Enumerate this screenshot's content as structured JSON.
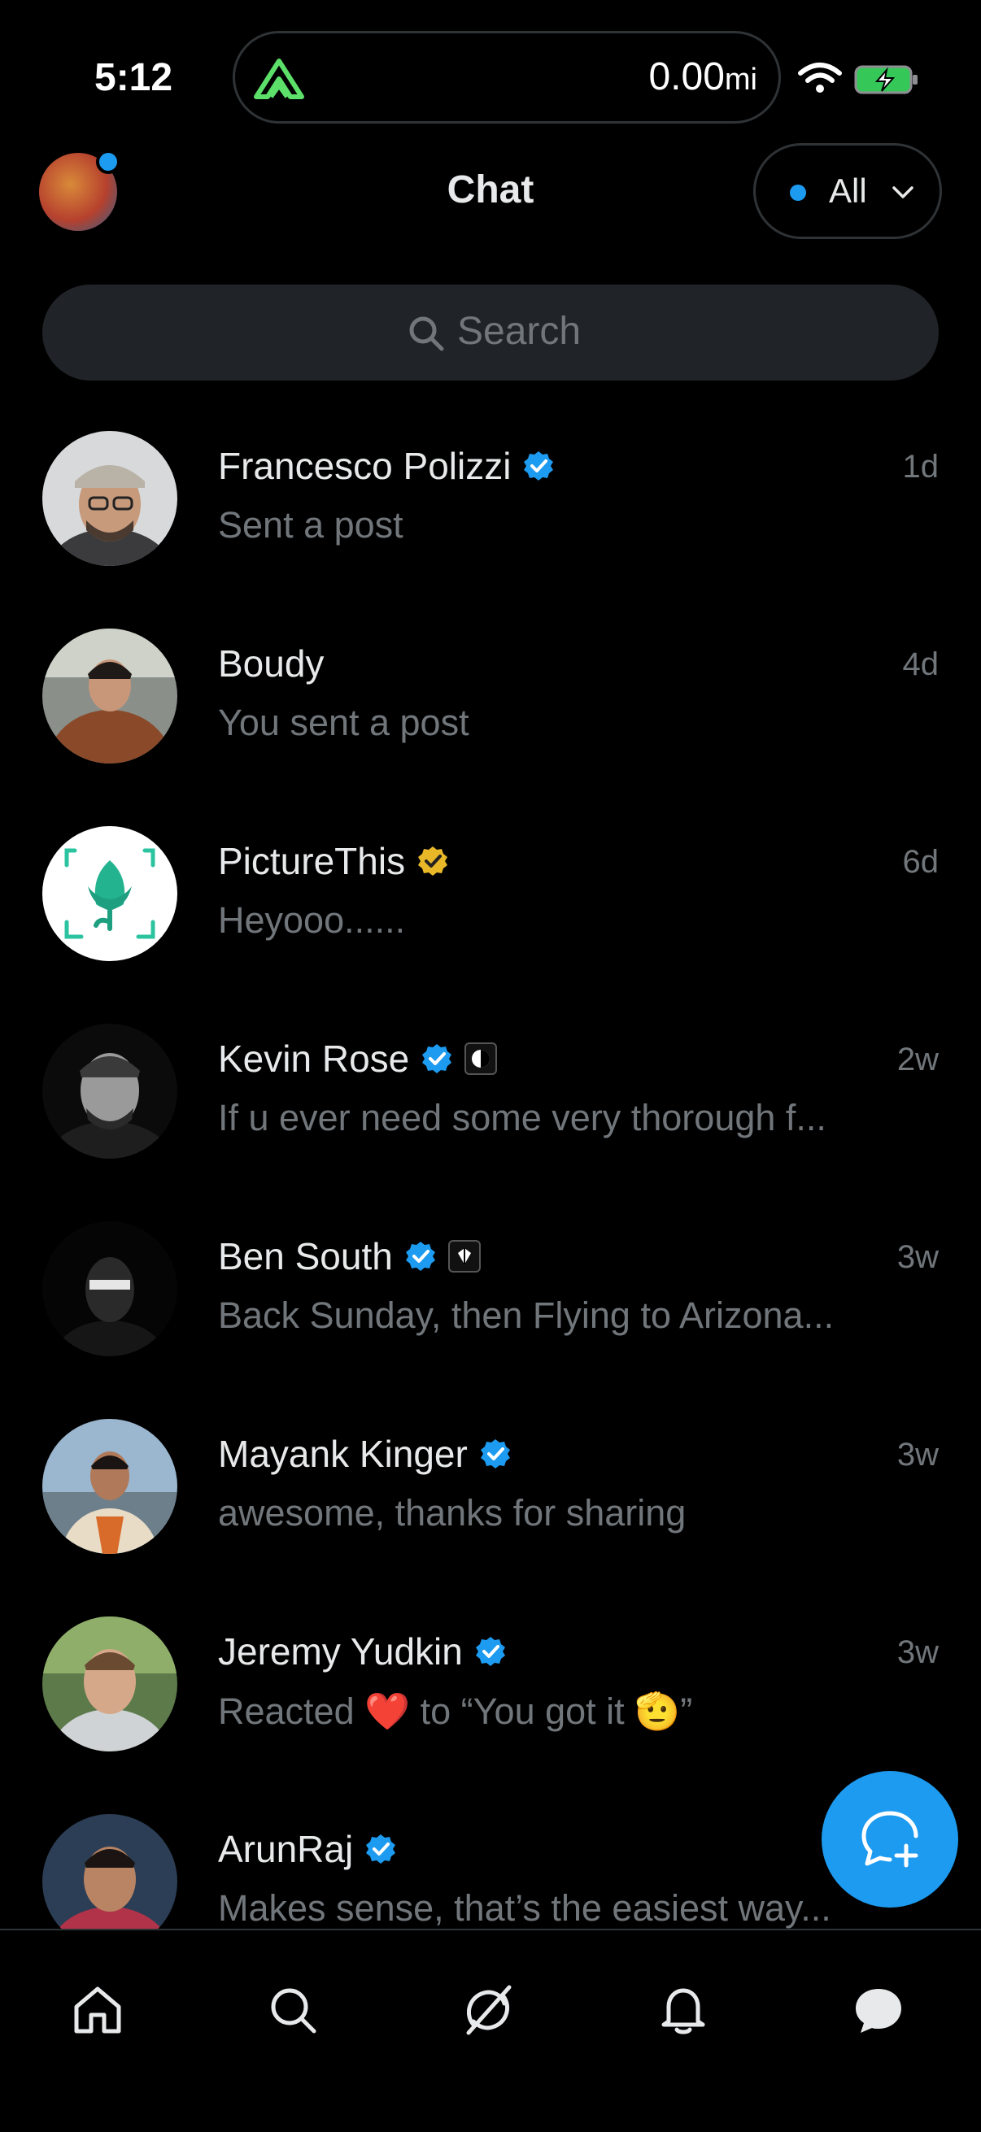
{
  "status_bar": {
    "time": "5:12",
    "activity_distance": "0.00",
    "activity_unit": "mi"
  },
  "header": {
    "title": "Chat",
    "filter_label": "All"
  },
  "search": {
    "placeholder": "Search"
  },
  "conversations": [
    {
      "name": "Francesco Polizzi",
      "verified": "blue",
      "preview": "Sent a post",
      "time": "1d"
    },
    {
      "name": "Boudy",
      "verified": "",
      "preview": "You sent a post",
      "time": "4d"
    },
    {
      "name": "PictureThis",
      "verified": "gold",
      "preview": "Heyooo......",
      "time": "6d"
    },
    {
      "name": "Kevin Rose",
      "verified": "blue",
      "preview": "If u ever need some very thorough f...",
      "time": "2w"
    },
    {
      "name": "Ben South",
      "verified": "blue",
      "preview": "Back Sunday, then Flying to Arizona...",
      "time": "3w"
    },
    {
      "name": "Mayank Kinger",
      "verified": "blue",
      "preview": "awesome, thanks for sharing",
      "time": "3w"
    },
    {
      "name": "Jeremy Yudkin",
      "verified": "blue",
      "preview": "Reacted ❤️ to “You got it 🫡”",
      "time": "3w"
    },
    {
      "name": "ArunRaj",
      "verified": "blue",
      "preview": "Makes sense, that’s the easiest way...",
      "time": ""
    }
  ],
  "tabs": [
    "home-icon",
    "search-icon",
    "grok-icon",
    "bell-icon",
    "chat-icon"
  ],
  "colors": {
    "accent": "#1d9bf0",
    "background": "#000000",
    "gold_badge": "#e8b829",
    "secondary_text": "#71767b"
  }
}
